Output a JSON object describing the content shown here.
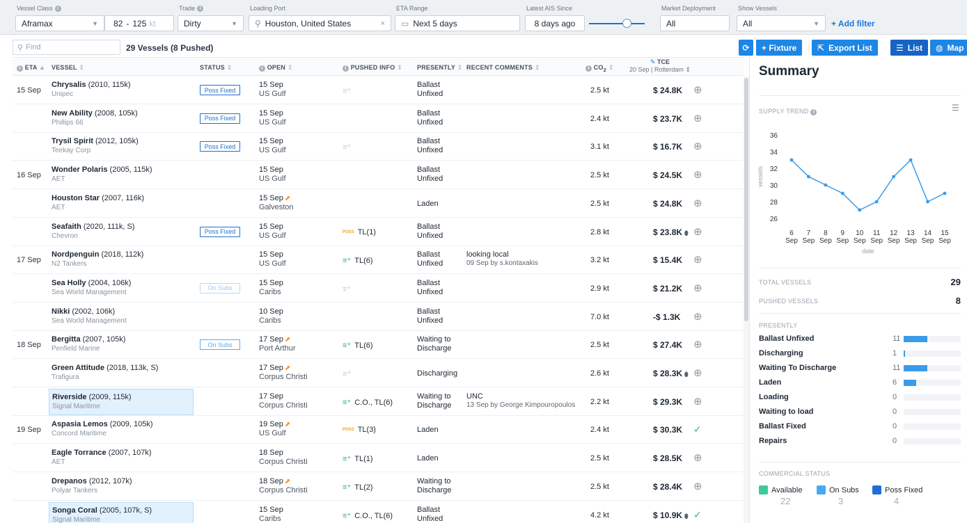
{
  "filters": {
    "vessel_class": {
      "label": "Vessel Class",
      "value": "Aframax",
      "range_min": "82",
      "range_sep": "-",
      "range_max": "125",
      "range_unit": "kt"
    },
    "trade": {
      "label": "Trade",
      "value": "Dirty"
    },
    "loading_port": {
      "label": "Loading Port",
      "value": "Houston, United States"
    },
    "eta_range": {
      "label": "ETA Range",
      "value": "Next 5 days"
    },
    "latest_ais": {
      "label": "Latest AIS Since",
      "value": "8 days ago",
      "slider_level": 0.68
    },
    "market_deployment": {
      "label": "Market Deployment",
      "value": "All"
    },
    "show_vessels": {
      "label": "Show Vessels",
      "value": "All"
    },
    "add_filter": "+ Add filter"
  },
  "toolbar": {
    "find_placeholder": "Find",
    "count": "29 Vessels (8 Pushed)",
    "fixture": "+ Fixture",
    "export": "Export List",
    "list": "List",
    "map": "Map"
  },
  "columns": {
    "eta": "ETA",
    "vessel": "VESSEL",
    "status": "STATUS",
    "open": "OPEN",
    "pushed": "PUSHED INFO",
    "presently": "PRESENTLY",
    "comments": "RECENT COMMENTS",
    "co2": "CO",
    "co2_sub": "2",
    "tce": "TCE",
    "tce_sub": "20 Sep | Rotterdam"
  },
  "rows": [
    {
      "eta": "15 Sep",
      "name": "Chrysalis",
      "meta": "(2010, 115k)",
      "owner": "Unipec",
      "status": "Poss Fixed",
      "status_type": "poss",
      "open_date": "15 Sep",
      "open_port": "US Gulf",
      "trend": false,
      "pushed_icon": "grey",
      "pushed": "",
      "pres1": "Ballast",
      "pres2": "Unfixed",
      "c1": "",
      "c2": "",
      "co2": "2.5 kt",
      "tce": "$ 24.8K",
      "drop": false,
      "action": "plus",
      "hl": false
    },
    {
      "eta": "",
      "name": "New Ability",
      "meta": "(2008, 105k)",
      "owner": "Phillips 66",
      "status": "Poss Fixed",
      "status_type": "poss",
      "open_date": "15 Sep",
      "open_port": "US Gulf",
      "trend": false,
      "pushed_icon": "",
      "pushed": "",
      "pres1": "Ballast",
      "pres2": "Unfixed",
      "c1": "",
      "c2": "",
      "co2": "2.4 kt",
      "tce": "$ 23.7K",
      "drop": false,
      "action": "plus",
      "hl": false
    },
    {
      "eta": "",
      "name": "Trysil Spirit",
      "meta": "(2012, 105k)",
      "owner": "Teekay Corp",
      "status": "Poss Fixed",
      "status_type": "poss",
      "open_date": "15 Sep",
      "open_port": "US Gulf",
      "trend": false,
      "pushed_icon": "grey",
      "pushed": "",
      "pres1": "Ballast",
      "pres2": "Unfixed",
      "c1": "",
      "c2": "",
      "co2": "3.1 kt",
      "tce": "$ 16.7K",
      "drop": false,
      "action": "plus",
      "hl": false
    },
    {
      "eta": "16 Sep",
      "name": "Wonder Polaris",
      "meta": "(2005, 115k)",
      "owner": "AET",
      "status": "",
      "status_type": "",
      "open_date": "15 Sep",
      "open_port": "US Gulf",
      "trend": false,
      "pushed_icon": "",
      "pushed": "",
      "pres1": "Ballast",
      "pres2": "Unfixed",
      "c1": "",
      "c2": "",
      "co2": "2.5 kt",
      "tce": "$ 24.5K",
      "drop": false,
      "action": "plus",
      "hl": false
    },
    {
      "eta": "",
      "name": "Houston Star",
      "meta": "(2007, 116k)",
      "owner": "AET",
      "status": "",
      "status_type": "",
      "open_date": "15 Sep",
      "open_port": "Galveston",
      "trend": true,
      "pushed_icon": "",
      "pushed": "",
      "pres1": "Laden",
      "pres2": "",
      "c1": "",
      "c2": "",
      "co2": "2.5 kt",
      "tce": "$ 24.8K",
      "drop": false,
      "action": "plus",
      "hl": false
    },
    {
      "eta": "",
      "name": "Seafaith",
      "meta": "(2020, 111k, S)",
      "owner": "Chevron",
      "status": "Poss Fixed",
      "status_type": "poss",
      "open_date": "15 Sep",
      "open_port": "US Gulf",
      "trend": false,
      "pushed_icon": "poss",
      "pushed": "TL(1)",
      "pres1": "Ballast",
      "pres2": "Unfixed",
      "c1": "",
      "c2": "",
      "co2": "2.8 kt",
      "tce": "$ 23.8K",
      "drop": true,
      "action": "plus",
      "hl": false
    },
    {
      "eta": "17 Sep",
      "name": "Nordpenguin",
      "meta": "(2018, 112k)",
      "owner": "N2 Tankers",
      "status": "",
      "status_type": "",
      "open_date": "15 Sep",
      "open_port": "US Gulf",
      "trend": false,
      "pushed_icon": "green",
      "pushed": "TL(6)",
      "pres1": "Ballast",
      "pres2": "Unfixed",
      "c1": "looking local",
      "c2": "09 Sep by s.kontaxakis",
      "co2": "3.2 kt",
      "tce": "$ 15.4K",
      "drop": false,
      "action": "plus",
      "hl": false
    },
    {
      "eta": "",
      "name": "Sea Holly",
      "meta": "(2004, 106k)",
      "owner": "Sea World Management",
      "status": "On Subs",
      "status_type": "subs-light",
      "open_date": "15 Sep",
      "open_port": "Caribs",
      "trend": false,
      "pushed_icon": "grey",
      "pushed": "",
      "pres1": "Ballast",
      "pres2": "Unfixed",
      "c1": "",
      "c2": "",
      "co2": "2.9 kt",
      "tce": "$ 21.2K",
      "drop": false,
      "action": "plus",
      "hl": false
    },
    {
      "eta": "",
      "name": "Nikki",
      "meta": "(2002, 106k)",
      "owner": "Sea World Management",
      "status": "",
      "status_type": "",
      "open_date": "10 Sep",
      "open_port": "Caribs",
      "trend": false,
      "pushed_icon": "",
      "pushed": "",
      "pres1": "Ballast",
      "pres2": "Unfixed",
      "c1": "",
      "c2": "",
      "co2": "7.0 kt",
      "tce": "-$ 1.3K",
      "drop": false,
      "action": "plus",
      "hl": false
    },
    {
      "eta": "18 Sep",
      "name": "Bergitta",
      "meta": "(2007, 105k)",
      "owner": "Penfield Marine",
      "status": "On Subs",
      "status_type": "subs",
      "open_date": "17 Sep",
      "open_port": "Port Arthur",
      "trend": true,
      "pushed_icon": "green",
      "pushed": "TL(6)",
      "pres1": "Waiting to",
      "pres2": "Discharge",
      "c1": "",
      "c2": "",
      "co2": "2.5 kt",
      "tce": "$ 27.4K",
      "drop": false,
      "action": "plus",
      "hl": false
    },
    {
      "eta": "",
      "name": "Green Attitude",
      "meta": "(2018, 113k, S)",
      "owner": "Trafigura",
      "status": "",
      "status_type": "",
      "open_date": "17 Sep",
      "open_port": "Corpus Christi",
      "trend": true,
      "pushed_icon": "grey",
      "pushed": "",
      "pres1": "Discharging",
      "pres2": "",
      "c1": "",
      "c2": "",
      "co2": "2.6 kt",
      "tce": "$ 28.3K",
      "drop": true,
      "action": "plus",
      "hl": false
    },
    {
      "eta": "",
      "name": "Riverside",
      "meta": "(2009, 115k)",
      "owner": "Signal Maritime",
      "status": "",
      "status_type": "",
      "open_date": "17 Sep",
      "open_port": "Corpus Christi",
      "trend": false,
      "pushed_icon": "green",
      "pushed": "C.O., TL(6)",
      "pres1": "Waiting to",
      "pres2": "Discharge",
      "c1": "UNC",
      "c2": "13 Sep by George Kimpouropoulos",
      "co2": "2.2 kt",
      "tce": "$ 29.3K",
      "drop": false,
      "action": "plus",
      "hl": true
    },
    {
      "eta": "19 Sep",
      "name": "Aspasia Lemos",
      "meta": "(2009, 105k)",
      "owner": "Concord Maritime",
      "status": "",
      "status_type": "",
      "open_date": "19 Sep",
      "open_port": "US Gulf",
      "trend": true,
      "pushed_icon": "poss",
      "pushed": "TL(3)",
      "pres1": "Laden",
      "pres2": "",
      "c1": "",
      "c2": "",
      "co2": "2.4 kt",
      "tce": "$ 30.3K",
      "drop": false,
      "action": "check",
      "hl": false
    },
    {
      "eta": "",
      "name": "Eagle Torrance",
      "meta": "(2007, 107k)",
      "owner": "AET",
      "status": "",
      "status_type": "",
      "open_date": "18 Sep",
      "open_port": "Corpus Christi",
      "trend": false,
      "pushed_icon": "green",
      "pushed": "TL(1)",
      "pres1": "Laden",
      "pres2": "",
      "c1": "",
      "c2": "",
      "co2": "2.5 kt",
      "tce": "$ 28.5K",
      "drop": false,
      "action": "plus",
      "hl": false
    },
    {
      "eta": "",
      "name": "Drepanos",
      "meta": "(2012, 107k)",
      "owner": "Polyar Tankers",
      "status": "",
      "status_type": "",
      "open_date": "18 Sep",
      "open_port": "Corpus Christi",
      "trend": true,
      "pushed_icon": "green",
      "pushed": "TL(2)",
      "pres1": "Waiting to",
      "pres2": "Discharge",
      "c1": "",
      "c2": "",
      "co2": "2.5 kt",
      "tce": "$ 28.4K",
      "drop": false,
      "action": "plus",
      "hl": false
    },
    {
      "eta": "",
      "name": "Songa Coral",
      "meta": "(2005, 107k, S)",
      "owner": "Signal Maritime",
      "status": "",
      "status_type": "",
      "open_date": "15 Sep",
      "open_port": "Caribs",
      "trend": false,
      "pushed_icon": "green",
      "pushed": "C.O., TL(6)",
      "pres1": "Ballast",
      "pres2": "Unfixed",
      "c1": "",
      "c2": "",
      "co2": "4.2 kt",
      "tce": "$ 10.9K",
      "drop": true,
      "action": "check",
      "hl": true
    }
  ],
  "summary": {
    "title": "Summary",
    "supply_trend_label": "SUPPLY TREND",
    "total_vessels_label": "TOTAL VESSELS",
    "total_vessels": "29",
    "pushed_vessels_label": "PUSHED VESSELS",
    "pushed_vessels": "8",
    "presently_label": "PRESENTLY",
    "presently": [
      {
        "label": "Ballast Unfixed",
        "value": "11",
        "frac": 0.41
      },
      {
        "label": "Discharging",
        "value": "1",
        "frac": 0.03
      },
      {
        "label": "Waiting To Discharge",
        "value": "11",
        "frac": 0.41
      },
      {
        "label": "Laden",
        "value": "6",
        "frac": 0.22
      },
      {
        "label": "Loading",
        "value": "0",
        "frac": 0
      },
      {
        "label": "Waiting to load",
        "value": "0",
        "frac": 0
      },
      {
        "label": "Ballast Fixed",
        "value": "0",
        "frac": 0
      },
      {
        "label": "Repairs",
        "value": "0",
        "frac": 0
      }
    ],
    "commercial_status_label": "COMMERCIAL STATUS",
    "commercial": [
      {
        "label": "Available",
        "value": "22",
        "color": "#3ec99a"
      },
      {
        "label": "On Subs",
        "value": "3",
        "color": "#4aa8f0"
      },
      {
        "label": "Poss Fixed",
        "value": "4",
        "color": "#1f6fd6"
      }
    ]
  },
  "chart_data": {
    "type": "line",
    "x": [
      "6",
      "7",
      "8",
      "9",
      "10",
      "11",
      "12",
      "13",
      "14",
      "15"
    ],
    "x_sub": "Sep",
    "values": [
      33,
      31,
      30,
      29,
      27,
      28,
      31,
      33,
      28,
      29
    ],
    "yticks": [
      26,
      28,
      30,
      32,
      34,
      36
    ],
    "ylim": [
      25,
      37
    ],
    "ylabel": "vessels",
    "xlabel": "date",
    "color": "#3b9be9"
  }
}
